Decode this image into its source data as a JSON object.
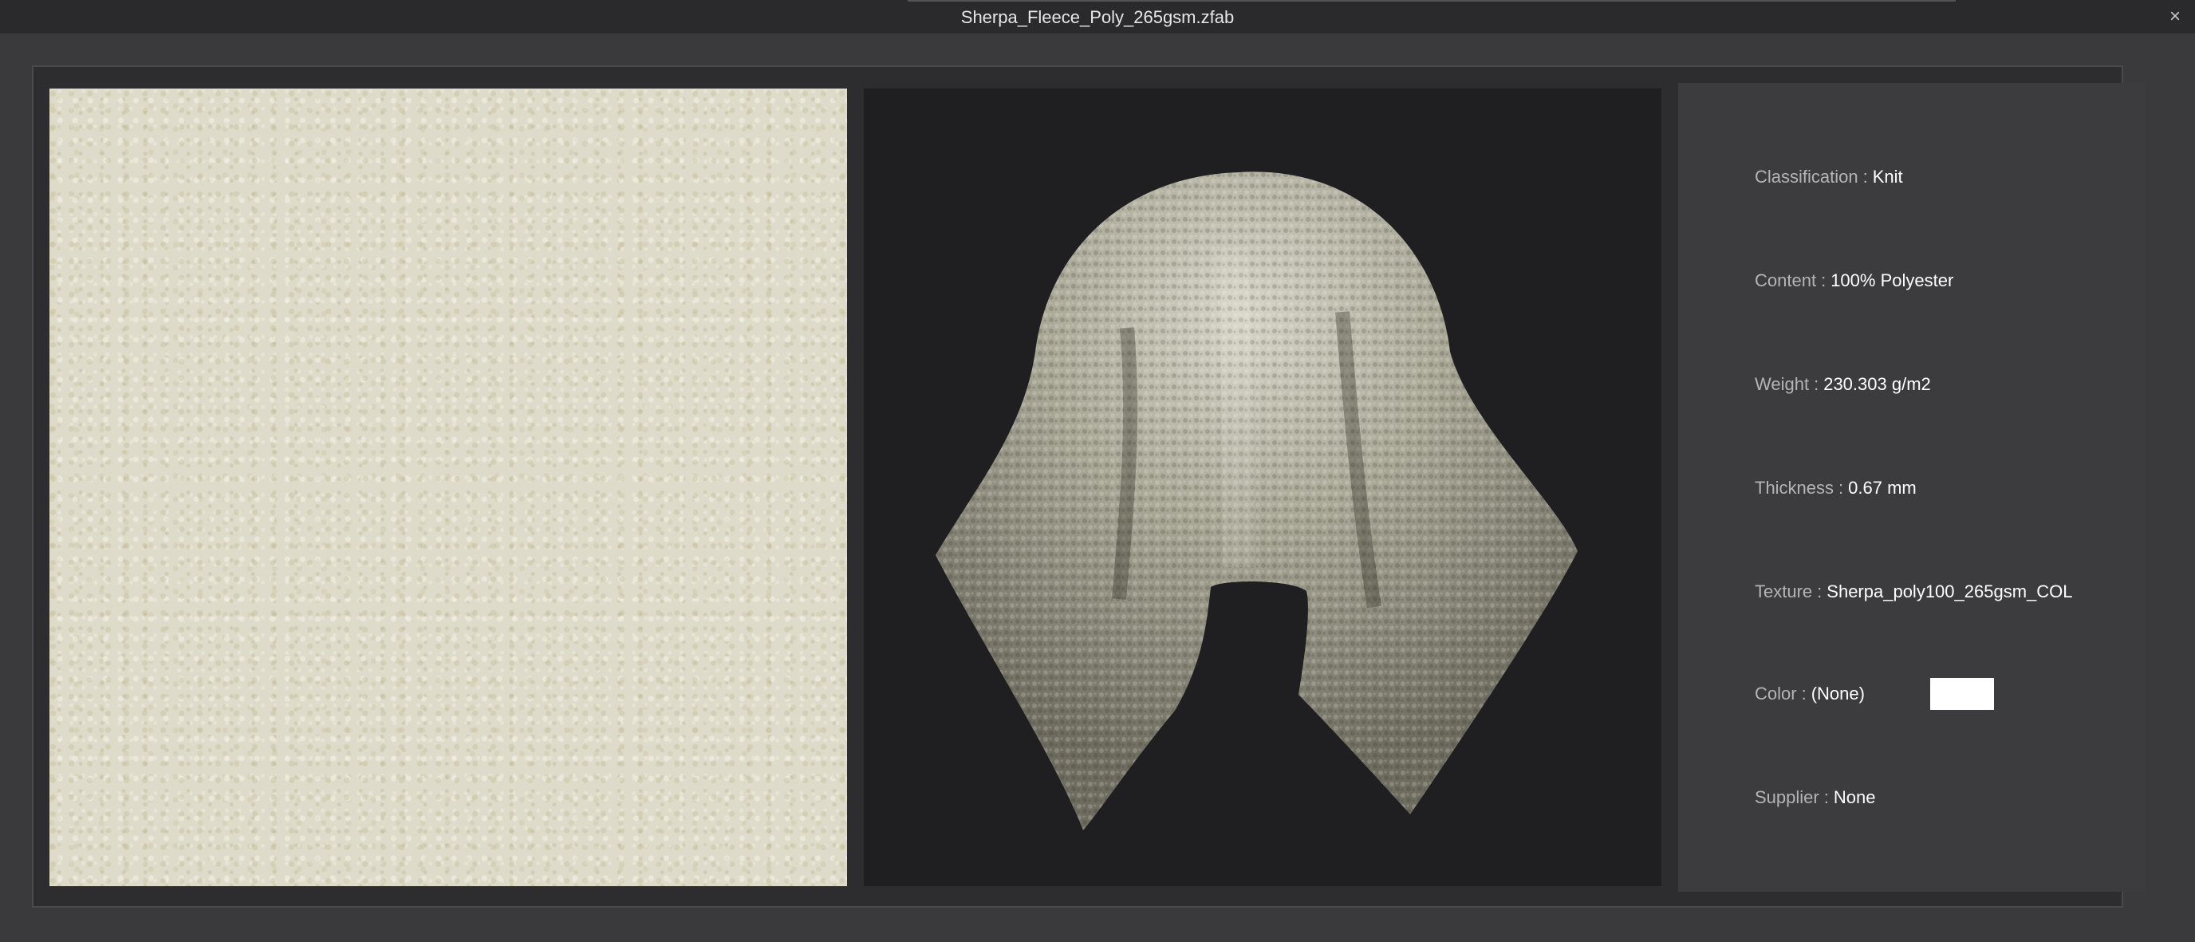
{
  "window": {
    "title": "Sherpa_Fleece_Poly_265gsm.zfab",
    "close_icon": "×"
  },
  "previews": {
    "texture_icon": "fabric-texture-swatch",
    "render_icon": "draped-fabric-render"
  },
  "info": {
    "separator": ":",
    "classification": {
      "label": "Classification",
      "value": "Knit"
    },
    "content": {
      "label": "Content",
      "value": "100% Polyester"
    },
    "weight": {
      "label": "Weight",
      "value": "230.303 g/m2"
    },
    "thickness": {
      "label": "Thickness",
      "value": "0.67 mm"
    },
    "texture": {
      "label": "Texture",
      "value": "Sherpa_poly100_265gsm_COL"
    },
    "color": {
      "label": "Color",
      "value": "(None)",
      "swatch": "#ffffff"
    },
    "supplier": {
      "label": "Supplier",
      "value": "None"
    }
  },
  "colors": {
    "background": "#3a3a3d",
    "titlebar": "#2a2a2d",
    "frame": "#2d2d30",
    "panel": "#3c3c3f",
    "render_bg": "#1f1f22",
    "fabric": "#dedbca"
  }
}
